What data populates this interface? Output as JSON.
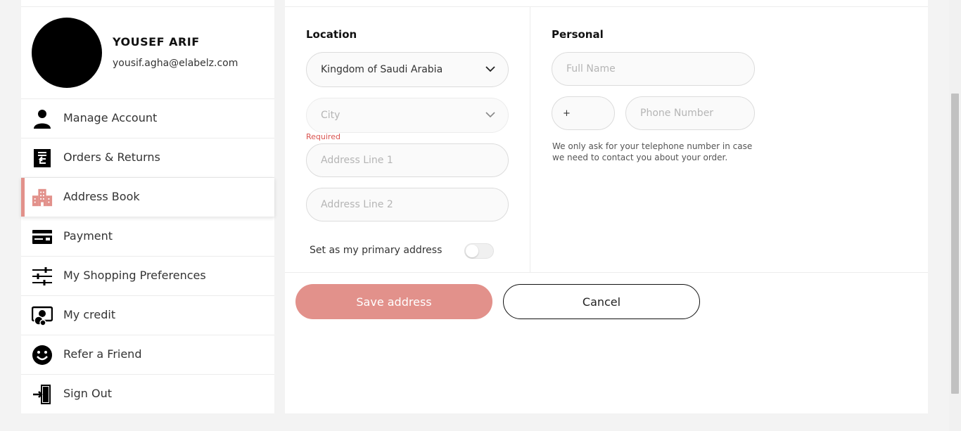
{
  "profile": {
    "name": "YOUSEF ARIF",
    "email": "yousif.agha@elabelz.com"
  },
  "nav": {
    "items": [
      {
        "label": "Manage Account",
        "icon": "person-icon"
      },
      {
        "label": "Orders & Returns",
        "icon": "return-box-icon"
      },
      {
        "label": "Address Book",
        "icon": "building-icon",
        "active": true
      },
      {
        "label": "Payment",
        "icon": "credit-card-icon"
      },
      {
        "label": "My Shopping Preferences",
        "icon": "sliders-icon"
      },
      {
        "label": "My credit",
        "icon": "wallet-coins-icon"
      },
      {
        "label": "Refer a Friend",
        "icon": "smiley-icon"
      },
      {
        "label": "Sign Out",
        "icon": "exit-door-icon"
      }
    ]
  },
  "location": {
    "title": "Location",
    "country_value": "Kingdom of Saudi Arabia",
    "city_placeholder": "City",
    "required_text": "Required",
    "address1_placeholder": "Address Line 1",
    "address2_placeholder": "Address Line 2",
    "primary_label": "Set as my primary address",
    "primary_on": false
  },
  "personal": {
    "title": "Personal",
    "fullname_placeholder": "Full Name",
    "phone_code": "+",
    "phone_placeholder": "Phone Number",
    "note": "We only ask for your telephone number in case we need to contact you about your order."
  },
  "actions": {
    "save_label": "Save address",
    "cancel_label": "Cancel"
  },
  "colors": {
    "accent": "#e2918b",
    "background": "#f3f3f3"
  }
}
